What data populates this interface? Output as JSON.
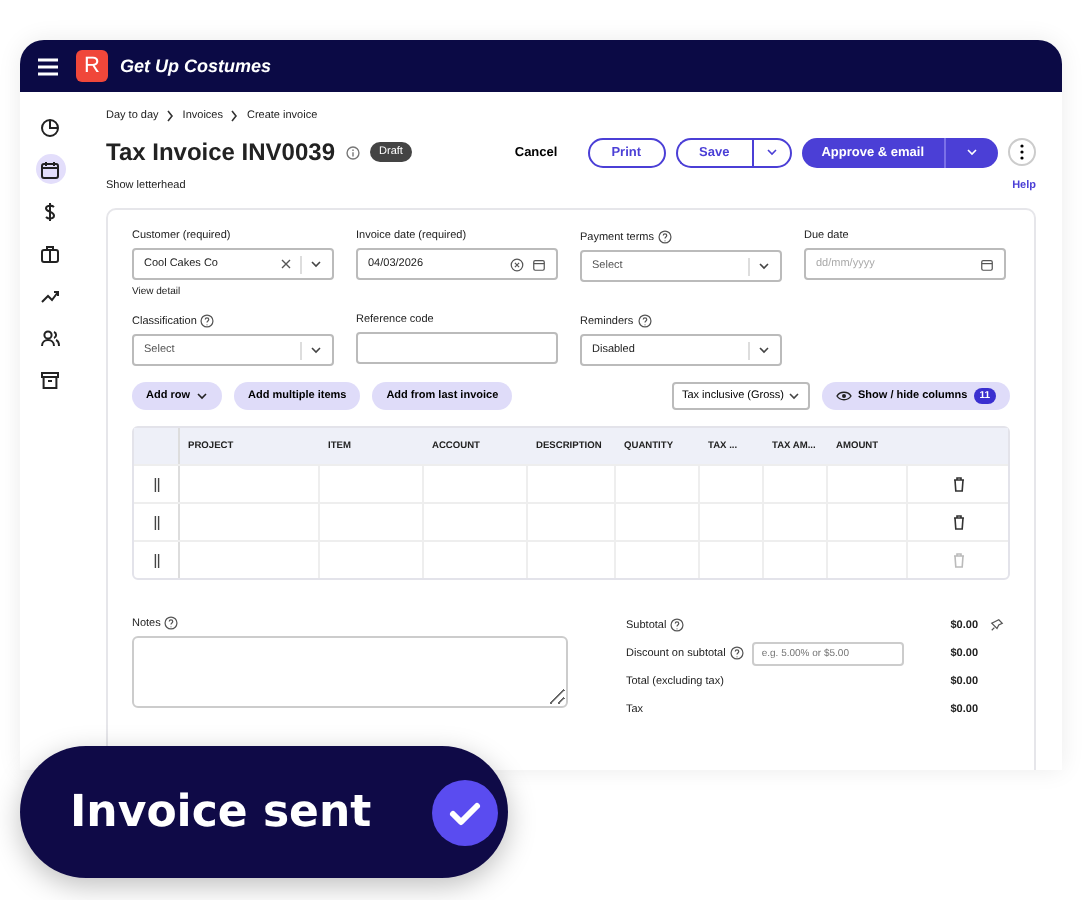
{
  "app": {
    "name": "Get Up Costumes",
    "logo": "R"
  },
  "sidebar": {
    "items": [
      {
        "selected": false
      },
      {
        "selected": true
      },
      {
        "selected": false
      },
      {
        "selected": false
      },
      {
        "selected": false
      },
      {
        "selected": false
      },
      {
        "selected": false
      }
    ]
  },
  "breadcrumb": [
    "Day to day",
    "Invoices",
    "Create invoice"
  ],
  "title": "Tax Invoice INV0039",
  "status": "Draft",
  "actions": {
    "cancel": "Cancel",
    "print": "Print",
    "save": "Save",
    "approve": "Approve & email"
  },
  "show_letterhead": "Show letterhead",
  "help": "Help",
  "form_rows": [
    [
      {
        "label": "Customer (required)",
        "info": false,
        "kind": "select",
        "value": "Cool Cakes Co",
        "clearable": true,
        "link": "View detail"
      },
      {
        "label": "Invoice date (required)",
        "info": false,
        "kind": "date",
        "value": "04/03/2026",
        "clearable": true
      },
      {
        "label": "Payment terms",
        "info": true,
        "kind": "select",
        "placeholder": "Select"
      },
      {
        "label": "Due date",
        "info": false,
        "kind": "date",
        "placeholder": "dd/mm/yyyy"
      }
    ],
    [
      {
        "label": "Classification",
        "info": true,
        "kind": "select",
        "placeholder": "Select"
      },
      {
        "label": "Reference code",
        "info": false,
        "kind": "text"
      },
      {
        "label": "Reminders",
        "info": true,
        "kind": "select",
        "value": "Disabled"
      }
    ]
  ],
  "toolbar": {
    "add_row": "Add row",
    "add_multiple": "Add multiple items",
    "add_last": "Add from last invoice",
    "tax_mode": "Tax inclusive (Gross)",
    "columns": "Show / hide columns",
    "columns_count": "11"
  },
  "table": {
    "columns": [
      "PROJECT",
      "ITEM",
      "ACCOUNT",
      "DESCRIPTION",
      "QUANTITY",
      "TAX ...",
      "TAX AM...",
      "AMOUNT"
    ],
    "rows": [
      {
        "delete_disabled": false
      },
      {
        "delete_disabled": false
      },
      {
        "delete_disabled": true
      }
    ]
  },
  "notes": {
    "label": "Notes"
  },
  "totals": [
    {
      "label": "Subtotal",
      "info": true,
      "value": "$0.00",
      "pin": true
    },
    {
      "label": "Discount on subtotal",
      "info": true,
      "value": "$0.00",
      "placeholder": "e.g. 5.00% or $5.00"
    },
    {
      "label": "Total (excluding tax)",
      "info": false,
      "value": "$0.00"
    },
    {
      "label": "Tax",
      "info": false,
      "value": "$0.00"
    }
  ],
  "toast": {
    "text": "Invoice sent"
  }
}
